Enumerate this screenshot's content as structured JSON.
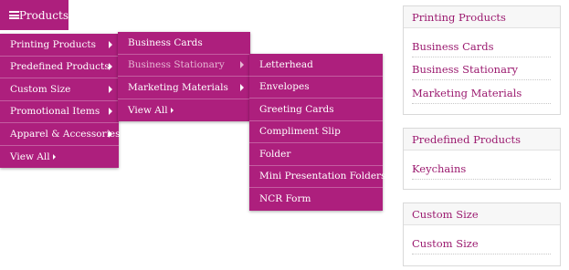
{
  "menu_button": {
    "label": "Products",
    "icon": "list-icon"
  },
  "level1": {
    "items": [
      {
        "label": "Printing Products",
        "has_submenu": true
      },
      {
        "label": "Predefined Products",
        "has_submenu": true
      },
      {
        "label": "Custom Size",
        "has_submenu": true
      },
      {
        "label": "Promotional Items",
        "has_submenu": true
      },
      {
        "label": "Apparel & Accessories",
        "has_submenu": true
      },
      {
        "label": "View All",
        "has_submenu": false
      }
    ]
  },
  "level2": {
    "items": [
      {
        "label": "Business Cards",
        "has_submenu": false
      },
      {
        "label": "Business Stationary",
        "has_submenu": true,
        "active": true
      },
      {
        "label": "Marketing Materials",
        "has_submenu": true
      },
      {
        "label": "View All",
        "has_submenu": false
      }
    ]
  },
  "level3": {
    "items": [
      {
        "label": "Letterhead"
      },
      {
        "label": "Envelopes"
      },
      {
        "label": "Greeting Cards"
      },
      {
        "label": "Compliment Slip"
      },
      {
        "label": "Folder"
      },
      {
        "label": "Mini Presentation Folders"
      },
      {
        "label": "NCR Form"
      }
    ]
  },
  "sidebar": {
    "boxes": [
      {
        "title": "Printing Products",
        "links": [
          "Business Cards",
          "Business Stationary",
          "Marketing Materials"
        ]
      },
      {
        "title": "Predefined Products",
        "links": [
          "Keychains"
        ]
      },
      {
        "title": "Custom Size",
        "links": [
          "Custom Size"
        ]
      }
    ]
  },
  "colors": {
    "accent": "#ad1f7d",
    "link": "#9b1a6f",
    "active_text": "#e6b7d4"
  }
}
